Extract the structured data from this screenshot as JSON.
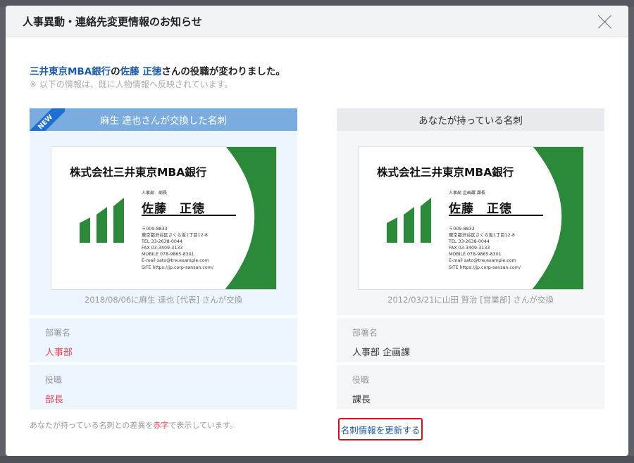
{
  "modal": {
    "title": "人事異動・連絡先変更情報のお知らせ",
    "close_icon": "close-icon"
  },
  "headline": {
    "company": "三井東京MBA銀行",
    "no": "の",
    "person": "佐藤 正徳",
    "rest": "さんの役職が変わりました。"
  },
  "note": "※ 以下の情報は、既に人物情報へ反映されています。",
  "left": {
    "badge": "NEW",
    "title": "麻生 達也さんが交換した名刺",
    "card": {
      "company": "株式会社三井東京MBA銀行",
      "dept": "人事部　部長",
      "name": "佐藤　正徳",
      "info": [
        "〒009-8833",
        "東京都渋谷区さくら坂1丁目12-8",
        "TEL 33-2638-0044",
        "FAX 03-3409-3133",
        "MOBILE 078-9865-8301",
        "E-mail sato@trw.example.com",
        "SITE https://jp.corp-sansan.com/"
      ]
    },
    "exchange": "2018/08/06に麻生 達也 [代表] さんが交換",
    "fields": [
      {
        "label": "部署名",
        "value": "人事部"
      },
      {
        "label": "役職",
        "value": "部長"
      }
    ]
  },
  "right": {
    "title": "あなたが持っている名刺",
    "card": {
      "company": "株式会社三井東京MBA銀行",
      "dept": "人事部 企画課 課長",
      "name": "佐藤　正徳",
      "info": [
        "〒009-8833",
        "東京都渋谷区さくら坂1丁目12-8",
        "TEL 33-2638-0044",
        "FAX 03-3409-3133",
        "MOBILE 078-9865-8301",
        "E-mail sato@trw.example.com",
        "SITE https://jp.corp-sansan.com/"
      ]
    },
    "exchange": "2012/03/21に山田 賢治 [営業部] さんが交換",
    "fields": [
      {
        "label": "部署名",
        "value": "人事部 企画課"
      },
      {
        "label": "役職",
        "value": "課長"
      }
    ]
  },
  "footnote": {
    "pre": "あなたが持っている名刺との差異を",
    "red": "赤字",
    "post": "で表示しています。"
  },
  "update_button": "名刺情報を更新する",
  "colors": {
    "accent": "#1a5aa8",
    "diff": "#e8404f",
    "highlight": "#d0101c",
    "card_green": "#2a8a3a"
  }
}
